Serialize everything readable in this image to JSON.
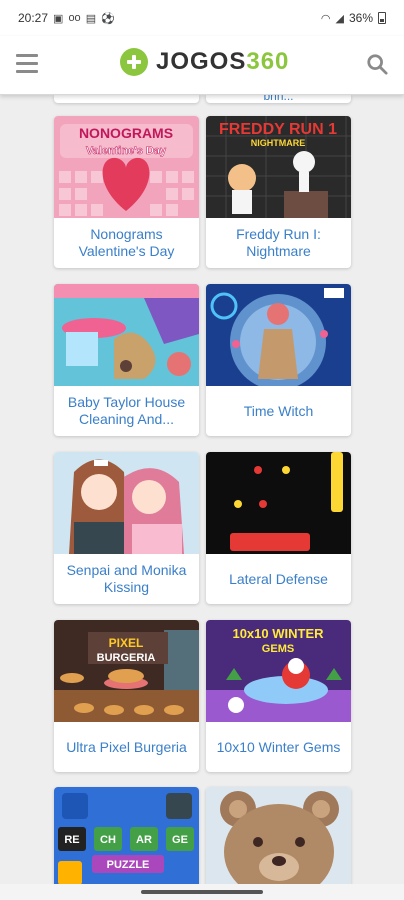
{
  "status": {
    "time": "20:27",
    "battery": "36%"
  },
  "header": {
    "logo_text": "JOGOS",
    "logo_num": "360"
  },
  "partial_top": [
    "",
    "brin..."
  ],
  "games": [
    {
      "title": "Nonograms Valentine's Day",
      "thumb_text": "NONOGRAMS Valentine's Day"
    },
    {
      "title": "Freddy Run I: Nightmare",
      "thumb_text": "FREDDY RUN 1 NIGHTMARE"
    },
    {
      "title": "Baby Taylor House Cleaning And...",
      "thumb_text": ""
    },
    {
      "title": "Time Witch",
      "thumb_text": ""
    },
    {
      "title": "Senpai and Monika Kissing",
      "thumb_text": ""
    },
    {
      "title": "Lateral Defense",
      "thumb_text": ""
    },
    {
      "title": "Ultra Pixel Burgeria",
      "thumb_text": "PIXEL BURGERIA"
    },
    {
      "title": "10x10 Winter Gems",
      "thumb_text": "10x10 WINTER GEMS"
    },
    {
      "title": "",
      "thumb_text": "RE CH AR GE PUZZLE"
    },
    {
      "title": "",
      "thumb_text": ""
    }
  ],
  "colors": {
    "accent": "#8cc63f",
    "title_text": "#3a7fc9",
    "background": "#eeeeee"
  }
}
